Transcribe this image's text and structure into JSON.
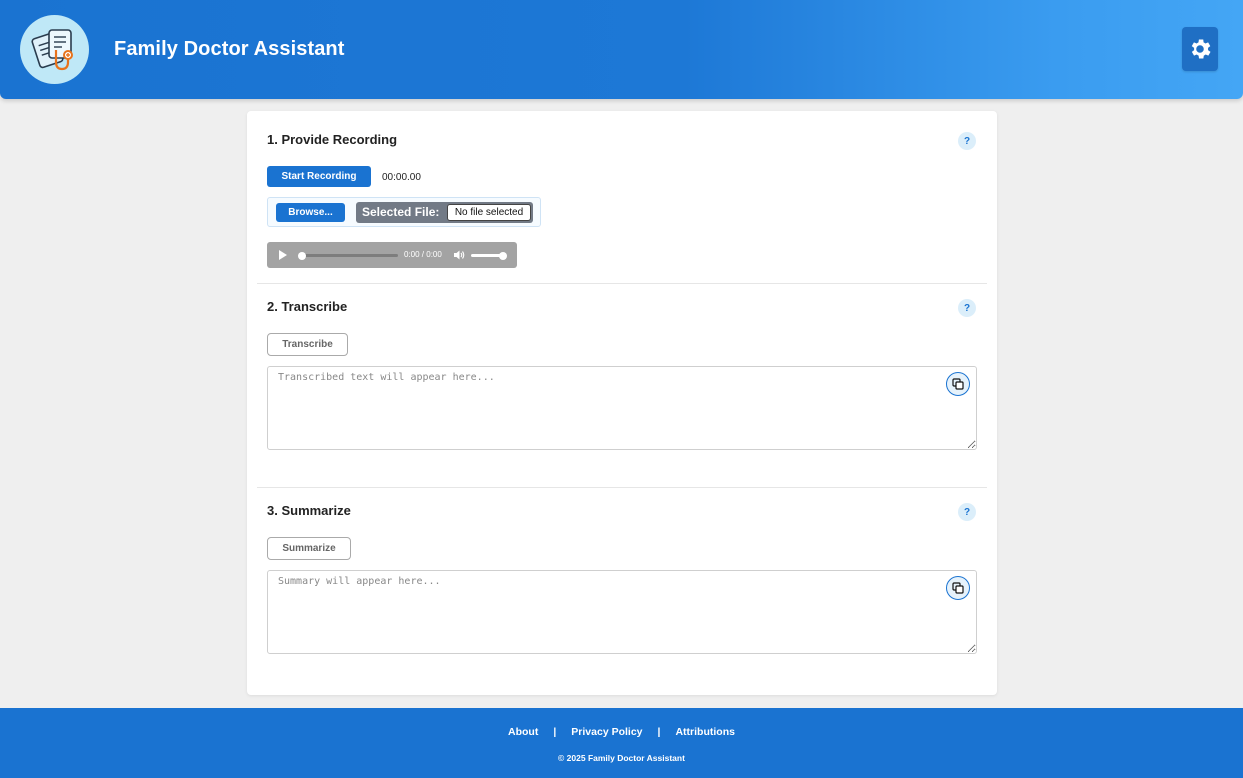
{
  "header": {
    "title": "Family Doctor Assistant",
    "logo_icon": "doctor-clipboard-stethoscope-icon",
    "settings_icon": "gear-icon"
  },
  "section1": {
    "title": "1. Provide Recording",
    "help_label": "?",
    "start_recording_label": "Start Recording",
    "timer": "00:00.00",
    "browse_label": "Browse...",
    "selected_file_label": "Selected File:",
    "selected_file_value": "No file selected",
    "audio": {
      "time_display": "0:00 / 0:00",
      "progress": 0,
      "volume": 1.0
    }
  },
  "section2": {
    "title": "2. Transcribe",
    "help_label": "?",
    "button_label": "Transcribe",
    "placeholder": "Transcribed text will appear here..."
  },
  "section3": {
    "title": "3. Summarize",
    "help_label": "?",
    "button_label": "Summarize",
    "placeholder": "Summary will appear here..."
  },
  "footer": {
    "links": [
      "About",
      "Privacy Policy",
      "Attributions"
    ],
    "separator": "|",
    "copyright": "© 2025 Family Doctor Assistant"
  },
  "colors": {
    "primary": "#1a73d1",
    "header_gradient_end": "#44a6f5",
    "background": "#efefef"
  }
}
